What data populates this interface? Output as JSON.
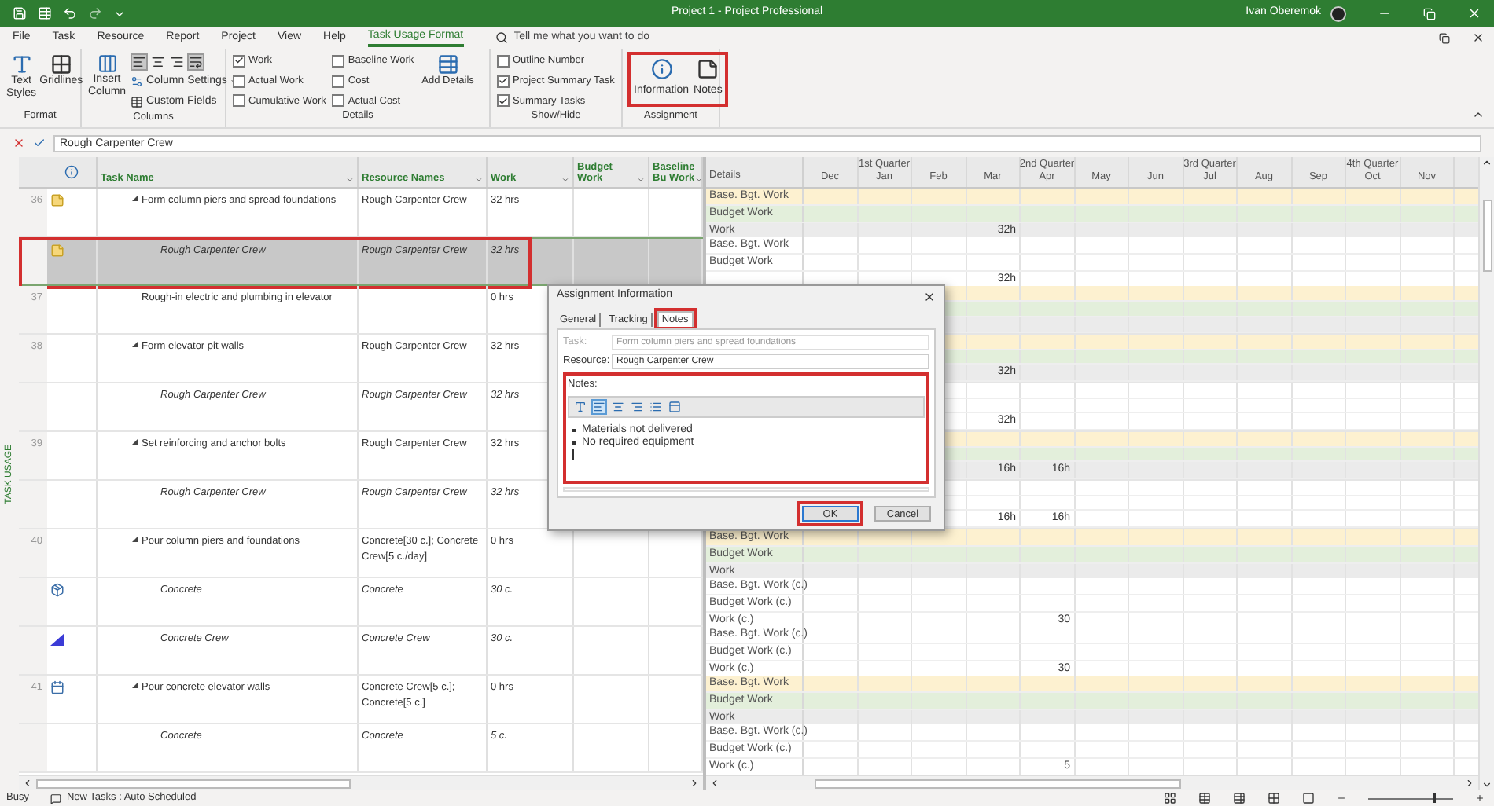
{
  "window": {
    "title": "Project 1  -  Project Professional",
    "user": "Ivan Oberemok"
  },
  "ribbon_tabs": [
    {
      "label": "File",
      "selected": false
    },
    {
      "label": "Task",
      "selected": false
    },
    {
      "label": "Resource",
      "selected": false
    },
    {
      "label": "Report",
      "selected": false
    },
    {
      "label": "Project",
      "selected": false
    },
    {
      "label": "View",
      "selected": false
    },
    {
      "label": "Help",
      "selected": false
    },
    {
      "label": "Task Usage Format",
      "selected": true
    }
  ],
  "tell_me": {
    "placeholder": "Tell me what you want to do"
  },
  "ribbon": {
    "format": {
      "label": "Format",
      "text_styles": "Text Styles",
      "gridlines": "Gridlines"
    },
    "columns": {
      "label": "Columns",
      "insert_column": "Insert Column",
      "column_settings": "Column Settings",
      "custom_fields": "Custom Fields",
      "align": [
        {
          "kind": "left",
          "selected": true
        },
        {
          "kind": "center",
          "selected": false
        },
        {
          "kind": "right",
          "selected": false
        },
        {
          "kind": "wrap",
          "selected": true
        }
      ]
    },
    "details": {
      "label": "Details",
      "checks": [
        {
          "label": "Work",
          "checked": true
        },
        {
          "label": "Actual Work",
          "checked": false
        },
        {
          "label": "Cumulative Work",
          "checked": false
        },
        {
          "label": "Baseline Work",
          "checked": false
        },
        {
          "label": "Cost",
          "checked": false
        },
        {
          "label": "Actual Cost",
          "checked": false
        }
      ],
      "add_details": "Add Details"
    },
    "show_hide": {
      "label": "Show/Hide",
      "checks": [
        {
          "label": "Outline Number",
          "checked": false
        },
        {
          "label": "Project Summary Task",
          "checked": true
        },
        {
          "label": "Summary Tasks",
          "checked": true
        }
      ]
    },
    "assignment": {
      "label": "Assignment",
      "highlighted": true,
      "buttons": [
        {
          "kind": "information",
          "label": "Information"
        },
        {
          "kind": "notes",
          "label": "Notes"
        }
      ]
    }
  },
  "entry_bar": {
    "value": "Rough Carpenter Crew"
  },
  "view_label": "TASK USAGE",
  "table": {
    "columns": [
      {
        "label": "Task Name"
      },
      {
        "label": "Resource Names"
      },
      {
        "label": "Work"
      },
      {
        "label": "Budget Work"
      },
      {
        "label": "Baseline Bu Work"
      }
    ],
    "rows": [
      {
        "id": "36",
        "kind": "task",
        "expanded": true,
        "indicator": {
          "kind": "note"
        },
        "name": "Form column piers and spread foundations",
        "resources": "Rough Carpenter Crew",
        "work": "32 hrs",
        "selected": false,
        "details": [
          {
            "kind": "baseline",
            "label": "Base. Bgt. Work"
          },
          {
            "kind": "budget",
            "label": "Budget Work"
          },
          {
            "kind": "work",
            "label": "Work",
            "values": {
              "3": "32h"
            }
          }
        ]
      },
      {
        "kind": "assignment",
        "indicator": {
          "kind": "note"
        },
        "name": "Rough Carpenter Crew",
        "resources": "Rough Carpenter Crew",
        "work": "32 hrs",
        "selected": true,
        "highlighted": true,
        "details": [
          {
            "kind": "baseline",
            "label": "Base. Bgt. Work"
          },
          {
            "kind": "budget",
            "label": "Budget Work"
          },
          {
            "kind": "work",
            "values": {
              "3": "32h"
            }
          }
        ]
      },
      {
        "id": "37",
        "kind": "task",
        "name": "Rough-in electric and plumbing in elevator",
        "work": "0 hrs",
        "selected": false,
        "details": [
          {
            "kind": "baseline"
          },
          {
            "kind": "budget"
          },
          {
            "kind": "work"
          }
        ]
      },
      {
        "id": "38",
        "kind": "task",
        "expanded": true,
        "name": "Form elevator pit walls",
        "resources": "Rough Carpenter Crew",
        "work": "32 hrs",
        "selected": false,
        "details": [
          {
            "kind": "baseline"
          },
          {
            "kind": "budget"
          },
          {
            "kind": "work",
            "values": {
              "3": "32h"
            }
          }
        ]
      },
      {
        "kind": "assignment",
        "name": "Rough Carpenter Crew",
        "resources": "Rough Carpenter Crew",
        "work": "32 hrs",
        "selected": false,
        "details": [
          {
            "kind": "baseline"
          },
          {
            "kind": "budget"
          },
          {
            "kind": "work",
            "values": {
              "3": "32h"
            }
          }
        ]
      },
      {
        "id": "39",
        "kind": "task",
        "expanded": true,
        "name": "Set reinforcing and anchor bolts",
        "resources": "Rough Carpenter Crew",
        "work": "32 hrs",
        "selected": false,
        "details": [
          {
            "kind": "baseline"
          },
          {
            "kind": "budget"
          },
          {
            "kind": "work",
            "values": {
              "3": "16h",
              "4": "16h"
            }
          }
        ]
      },
      {
        "kind": "assignment",
        "name": "Rough Carpenter Crew",
        "resources": "Rough Carpenter Crew",
        "work": "32 hrs",
        "selected": false,
        "details": [
          {
            "kind": "baseline"
          },
          {
            "kind": "budget"
          },
          {
            "kind": "work",
            "values": {
              "3": "16h",
              "4": "16h"
            }
          }
        ]
      },
      {
        "id": "40",
        "kind": "task",
        "expanded": true,
        "name": "Pour column piers and foundations",
        "resources": "Concrete[30 c.]; Concrete Crew[5 c./day]",
        "work": "0 hrs",
        "selected": false,
        "details": [
          {
            "kind": "baseline",
            "label": "Base. Bgt. Work"
          },
          {
            "kind": "budget",
            "label": "Budget Work"
          },
          {
            "kind": "work",
            "label": "Work"
          }
        ]
      },
      {
        "kind": "assignment",
        "indicator": {
          "kind": "material"
        },
        "name": "Concrete",
        "resources": "Concrete",
        "work": "30 c.",
        "selected": false,
        "details": [
          {
            "kind": "baseline",
            "label": "Base. Bgt. Work (c.)"
          },
          {
            "kind": "budget",
            "label": "Budget Work (c.)"
          },
          {
            "kind": "work",
            "label": "Work (c.)",
            "values": {
              "4": "30"
            }
          }
        ]
      },
      {
        "kind": "assignment",
        "indicator": {
          "kind": "contour"
        },
        "name": "Concrete Crew",
        "resources": "Concrete Crew",
        "work": "30 c.",
        "selected": false,
        "details": [
          {
            "kind": "baseline",
            "label": "Base. Bgt. Work (c.)"
          },
          {
            "kind": "budget",
            "label": "Budget Work (c.)"
          },
          {
            "kind": "work",
            "label": "Work (c.)",
            "values": {
              "4": "30"
            }
          }
        ]
      },
      {
        "id": "41",
        "kind": "task",
        "expanded": true,
        "indicator": {
          "kind": "calendar"
        },
        "name": "Pour concrete elevator walls",
        "resources": "Concrete Crew[5 c.]; Concrete[5 c.]",
        "work": "0 hrs",
        "selected": false,
        "details": [
          {
            "kind": "baseline",
            "label": "Base. Bgt. Work"
          },
          {
            "kind": "budget",
            "label": "Budget Work"
          },
          {
            "kind": "work",
            "label": "Work"
          }
        ]
      },
      {
        "kind": "assignment",
        "name": "Concrete",
        "resources": "Concrete",
        "work": "5 c.",
        "selected": false,
        "details": [
          {
            "kind": "baseline",
            "label": "Base. Bgt. Work (c.)"
          },
          {
            "kind": "budget",
            "label": "Budget Work (c.)"
          },
          {
            "kind": "work",
            "label": "Work (c.)",
            "values": {
              "4": "5"
            }
          }
        ]
      }
    ]
  },
  "usage_grid": {
    "heading": "Details",
    "months": [
      {
        "label": "Dec"
      },
      {
        "label": "Jan",
        "quarter": "1st Quarter"
      },
      {
        "label": "Feb"
      },
      {
        "label": "Mar"
      },
      {
        "label": "Apr",
        "quarter": "2nd Quarter"
      },
      {
        "label": "May"
      },
      {
        "label": "Jun"
      },
      {
        "label": "Jul",
        "quarter": "3rd Quarter"
      },
      {
        "label": "Aug"
      },
      {
        "label": "Sep"
      },
      {
        "label": "Oct",
        "quarter": "4th Quarter"
      },
      {
        "label": "Nov"
      }
    ]
  },
  "dialog": {
    "title": "Assignment Information",
    "tabs": [
      {
        "label": "General",
        "selected": false,
        "highlighted": false
      },
      {
        "label": "Tracking",
        "selected": false,
        "highlighted": false
      },
      {
        "label": "Notes",
        "selected": true,
        "highlighted": true
      }
    ],
    "task_label": "Task:",
    "task_value": "Form column piers and spread foundations",
    "resource_label": "Resource:",
    "resource_value": "Rough Carpenter Crew",
    "notes_label": "Notes:",
    "notes_highlighted": true,
    "toolbar": [
      {
        "kind": "font",
        "selected": false
      },
      {
        "kind": "align-left",
        "selected": true
      },
      {
        "kind": "align-center",
        "selected": false
      },
      {
        "kind": "align-right",
        "selected": false
      },
      {
        "kind": "bullets",
        "selected": false
      },
      {
        "kind": "object",
        "selected": false
      }
    ],
    "notes": [
      "Materials not delivered",
      "No required equipment"
    ],
    "buttons": [
      {
        "kind": "ok",
        "label": "OK",
        "highlighted": true
      },
      {
        "kind": "cancel",
        "label": "Cancel",
        "highlighted": false
      }
    ]
  },
  "status_bar": {
    "status": "Busy",
    "scheduling": "New Tasks : Auto Scheduled",
    "zoom_slider": {
      "level": 0.78
    }
  }
}
